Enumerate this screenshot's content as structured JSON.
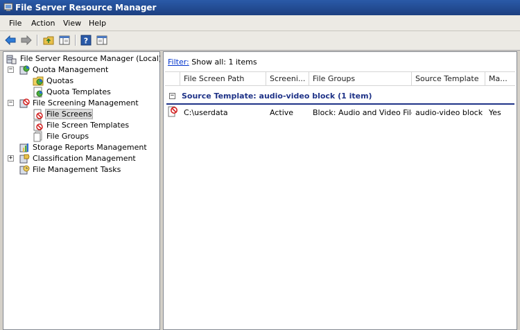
{
  "window": {
    "title": "File Server Resource Manager"
  },
  "menu": [
    "File",
    "Action",
    "View",
    "Help"
  ],
  "toolbar": {
    "buttons": [
      "back-arrow-icon",
      "forward-arrow-icon",
      "up-folder-icon",
      "show-hide-console-tree-icon",
      "help-icon",
      "properties-icon"
    ]
  },
  "tree": {
    "root": "File Server Resource Manager (Local)",
    "quota_management": "Quota Management",
    "quotas": "Quotas",
    "quota_templates": "Quota Templates",
    "file_screening_management": "File Screening Management",
    "file_screens": "File Screens",
    "file_screen_templates": "File Screen Templates",
    "file_groups": "File Groups",
    "storage_reports": "Storage Reports Management",
    "classification": "Classification Management",
    "file_management_tasks": "File Management Tasks",
    "expander_minus": "−",
    "expander_plus": "+"
  },
  "filter": {
    "link": "Filter:",
    "text": "Show all: 1 items"
  },
  "columns": [
    "File Screen Path",
    "Screeni...",
    "File Groups",
    "Source Template",
    "Ma..."
  ],
  "group": {
    "label": "Source Template: audio-video block (1 item)",
    "toggle": "−"
  },
  "rows": [
    {
      "path": "C:\\userdata",
      "status": "Active",
      "file_groups": "Block: Audio and Video Files",
      "source_template": "audio-video block",
      "matches": "Yes"
    }
  ],
  "colors": {
    "title_bar": "#1c3f80",
    "group_text": "#1e3287",
    "link": "#0033cc",
    "block_red": "#d32020"
  }
}
